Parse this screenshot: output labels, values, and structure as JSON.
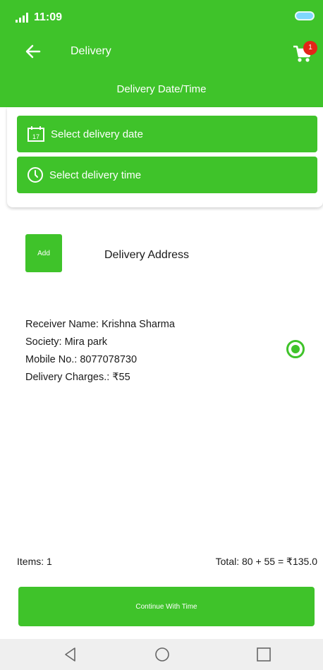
{
  "status_bar": {
    "time": "11:09"
  },
  "header": {
    "title": "Delivery",
    "subtitle": "Delivery Date/Time",
    "cart_badge": "1"
  },
  "date_time": {
    "date_button": "Select delivery date",
    "time_button": "Select delivery time",
    "calendar_day": "17"
  },
  "address": {
    "add_button": "Add",
    "title": "Delivery Address",
    "receiver": "Receiver Name:  Krishna Sharma",
    "society": "Society: Mira park",
    "mobile": "Mobile No.: 8077078730",
    "charges": "Delivery Charges.: ₹55"
  },
  "footer": {
    "items": "Items: 1",
    "total": "Total: 80 + 55 = ₹135.0",
    "continue_button": "Continue With Time"
  },
  "colors": {
    "primary": "#3fc32a",
    "badge": "#e32418",
    "nav_bg": "#efefef"
  },
  "icons": [
    "back-arrow-icon",
    "cart-icon",
    "calendar-icon",
    "clock-icon",
    "radio-selected-icon",
    "nav-back-icon",
    "nav-home-icon",
    "nav-recents-icon"
  ]
}
